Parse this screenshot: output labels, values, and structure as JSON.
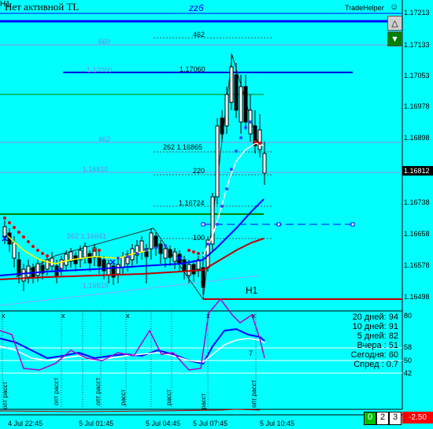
{
  "header": {
    "title": "Нет активной TL",
    "timeframe_tag": "H1",
    "zz_label": "zz6",
    "trade_helper": "TradeHelper",
    "settings_icon": "smiley-icon"
  },
  "buttons": {
    "up": "up-arrow-icon",
    "down": "down-arrow-icon"
  },
  "price_scale": [
    "1.17213",
    "1.17133",
    "1.17053",
    "1.16978",
    "1.16898",
    "1.16818",
    "1.16738",
    "1.16658",
    "1.16578",
    "1.16498"
  ],
  "current_price": "1.16812",
  "levels": {
    "l462_top": "462",
    "l660": "660",
    "l17060": "1.17060",
    "l17060_light": "1.17060",
    "l462_mid": "462",
    "l262": "262 1.16865",
    "l220": "220",
    "l16810": "1.16810",
    "l16724": "1.16724",
    "l262b": "262 1.16641",
    "l100": "100",
    "l16519": "1.16519",
    "h1_bottom": "H1"
  },
  "indicator": {
    "scale_80": "80",
    "scale_58": "58",
    "scale_50": "50",
    "scale_42": "42",
    "scale_7": "7",
    "stats": [
      "20 дней: 94",
      "10 дней: 91",
      "5 дней: 82",
      "Вчера   : 51",
      "Сегодня: 60",
      "Спред  : 0.7"
    ],
    "vlabels": [
      "опт расст",
      "опт расст",
      "опт расст",
      "расст",
      "расст",
      "расст",
      "опт расст"
    ]
  },
  "time_axis": [
    "4 Jul 22:45",
    "5 Jul 01:45",
    "5 Jul 04:45",
    "5 Jul 07:45",
    "5 Jul 10:45"
  ],
  "bottom_badges": {
    "b0": "0",
    "b2": "2",
    "b3": "3",
    "value": "-2.50"
  },
  "colors": {
    "background": "#00ffff",
    "blue_line": "#0000ff",
    "green_line": "#008000",
    "red_line": "#c00000",
    "badge_green": "#00c000",
    "badge_red": "#ff0000"
  }
}
